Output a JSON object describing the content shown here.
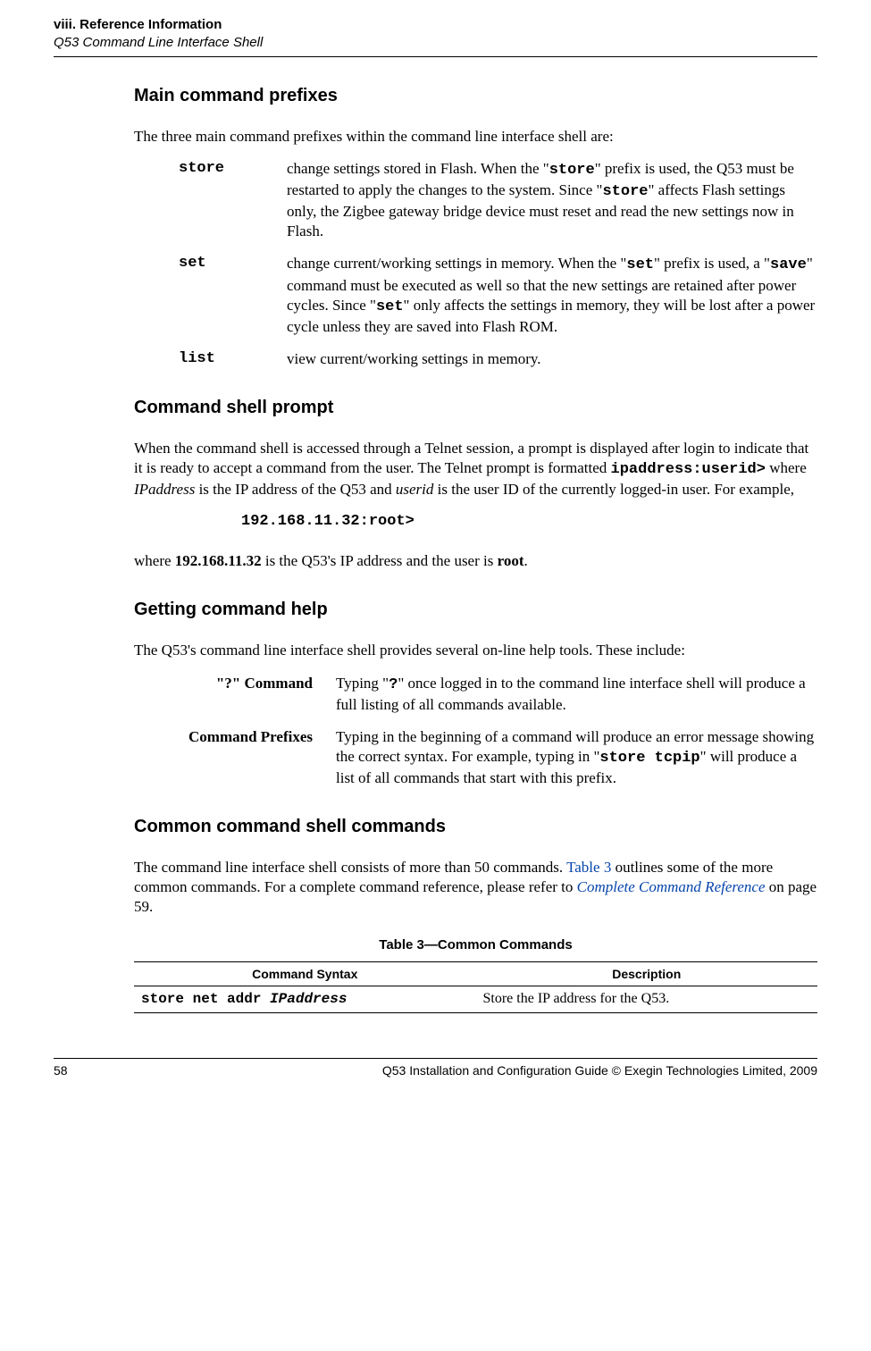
{
  "header": {
    "section": "viii. Reference Information",
    "subtitle": "Q53 Command Line Interface Shell"
  },
  "sec1": {
    "title": "Main command prefixes",
    "intro": "The three main command prefixes within the command line interface shell are:",
    "items": [
      {
        "term": "store",
        "pre1": "change settings stored in Flash. When the \"",
        "t1": "store",
        "mid1": "\" prefix is used, the Q53 must be restarted to apply the changes to the system. Since \"",
        "t2": "store",
        "post1": "\" affects Flash settings only, the Zigbee gateway bridge device must reset and read the new settings now in Flash."
      },
      {
        "term": "set",
        "pre1": "change current/working settings in memory. When the \"",
        "t1": "set",
        "mid1": "\" prefix is used, a \"",
        "t2": "save",
        "mid2": "\" command must be executed as well so that the new settings are retained after power cycles. Since \"",
        "t3": "set",
        "post1": "\" only affects the settings in memory, they will be lost after a power cycle unless they are saved into Flash ROM."
      },
      {
        "term": "list",
        "desc": "view current/working settings in memory."
      }
    ]
  },
  "sec2": {
    "title": "Command shell prompt",
    "p1a": "When the command shell is accessed through a Telnet session, a prompt is displayed after login to indicate that it is ready to accept a command from the user. The Telnet prompt is formatted ",
    "p1code": "ipaddress:userid>",
    "p1b": " where ",
    "p1i1": "IPaddress",
    "p1c": " is the IP address of the Q53 and ",
    "p1i2": "userid",
    "p1d": " is the user ID of the currently logged-in user. For example,",
    "prompt": "192.168.11.32:root>",
    "p2a": "where ",
    "p2b1": "192.168.11.32",
    "p2c": " is the Q53's IP address and the user is ",
    "p2b2": "root",
    "p2d": "."
  },
  "sec3": {
    "title": "Getting command help",
    "intro": "The Q53's command line interface shell provides several on-line help tools. These include:",
    "items": [
      {
        "label": "\"?\" Command",
        "pre": "Typing \"",
        "code": "?",
        "post": "\" once logged in to the command line interface shell will produce a full listing of all commands available."
      },
      {
        "label": "Command Prefixes",
        "pre": "Typing in the beginning of a command will produce an error message showing the correct syntax. For example, typing in \"",
        "code": "store tcpip",
        "post": "\" will produce a list of all commands that start with this prefix."
      }
    ]
  },
  "sec4": {
    "title": "Common command shell commands",
    "p1a": "The command line interface shell consists of more than 50 commands. ",
    "p1link1": "Table 3",
    "p1b": " outlines some of the more common commands. For a complete command reference, please refer to ",
    "p1link2": "Complete Command Reference",
    "p1c": " on page 59.",
    "table_caption": "Table 3—Common Commands",
    "th1": "Command Syntax",
    "th2": "Description",
    "row1cmd_a": "store net addr ",
    "row1cmd_b": "IPaddress",
    "row1desc": "Store the IP address for the Q53."
  },
  "footer": {
    "page": "58",
    "text": "Q53 Installation and Configuration Guide  © Exegin Technologies Limited, 2009"
  }
}
